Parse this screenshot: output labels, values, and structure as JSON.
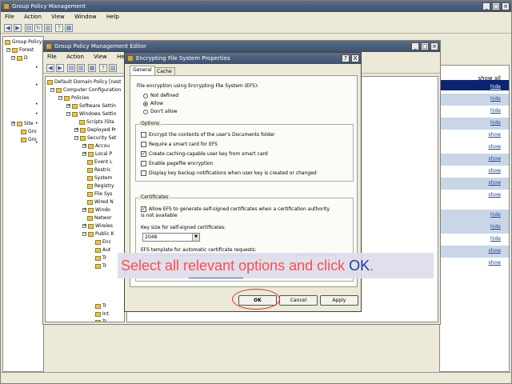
{
  "outer_window": {
    "title": "Group Policy Management",
    "menu": [
      "File",
      "Action",
      "View",
      "Window",
      "Help"
    ],
    "tree": [
      "Group Policy",
      "Forest",
      "D",
      "",
      "",
      "",
      "",
      "",
      "Site",
      "Gro",
      "Gro"
    ],
    "right_header": "show all",
    "right_links": [
      "hide",
      "hide",
      "hide",
      "hide",
      "show",
      "show",
      "show",
      "show",
      "show",
      "show",
      "hide",
      "hide",
      "hide",
      "show",
      "show"
    ]
  },
  "editor_window": {
    "title": "Group Policy Management Editor",
    "menu": [
      "File",
      "Action",
      "View",
      "Help"
    ],
    "tree": [
      "Default Domain Policy [nest",
      "Computer Configuration",
      "Policies",
      "Software Settin",
      "Windows Settin",
      "Scripts (Sta",
      "Deployed Pr",
      "Security Set",
      "Accou",
      "Local P",
      "Event L",
      "Restric",
      "System",
      "Registry",
      "File Sys",
      "Wired N",
      "Windo",
      "Networ",
      "Wireles",
      "Public K",
      "Enc",
      "Aut",
      "Tr",
      "Tr",
      "Tr",
      "Int",
      "Tr",
      "Tr"
    ]
  },
  "dialog": {
    "title": "Encrypting File System Properties",
    "help_button": "?",
    "close_button": "X",
    "tabs": [
      "General",
      "Cache"
    ],
    "efs_group_label": "File encryption using Encrypting File System (EFS):",
    "efs_options": [
      {
        "label": "Not defined",
        "selected": false
      },
      {
        "label": "Allow",
        "selected": true
      },
      {
        "label": "Don't allow",
        "selected": false
      }
    ],
    "options_label": "Options",
    "options": [
      {
        "label": "Encrypt the contents of the user's Documents folder",
        "checked": false
      },
      {
        "label": "Require a smart card for EFS",
        "checked": false
      },
      {
        "label": "Create caching-capable user key from smart card",
        "checked": true
      },
      {
        "label": "Enable pagefile encryption",
        "checked": false
      },
      {
        "label": "Display key backup notifications when user key is created or changed",
        "checked": false
      }
    ],
    "certificates_label": "Certificates",
    "cert_checkbox": {
      "label": "Allow EFS to generate self-signed certificates when a certification authority is not available",
      "checked": true
    },
    "key_size_label": "Key size for self-signed certificates:",
    "key_size_value": "2048",
    "template_label": "EFS template for automatic certificate requests:",
    "buttons": {
      "ok": "OK",
      "cancel": "Cancel",
      "apply": "Apply"
    }
  },
  "callout": {
    "text_before": "Select all relevant options and click ",
    "highlight": "OK",
    "text_after": "."
  },
  "colors": {
    "callout_text": "#ff4d4d",
    "callout_highlight": "#1f3c9c",
    "circle": "#e03030",
    "title_bar": "#4a5d7a"
  }
}
